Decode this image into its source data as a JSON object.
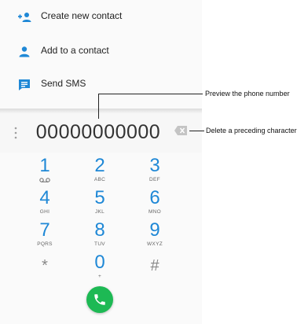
{
  "menu": {
    "items": [
      {
        "label": "Create new contact",
        "icon": "add-person-icon"
      },
      {
        "label": "Add to a contact",
        "icon": "person-icon"
      },
      {
        "label": "Send SMS",
        "icon": "sms-icon"
      }
    ]
  },
  "dialer": {
    "number": "00000000000",
    "overflow_icon": "more-vert-icon",
    "delete_icon": "backspace-icon"
  },
  "keypad": [
    {
      "digit": "1",
      "letters": "",
      "voicemail": true
    },
    {
      "digit": "2",
      "letters": "ABC"
    },
    {
      "digit": "3",
      "letters": "DEF"
    },
    {
      "digit": "4",
      "letters": "GHI"
    },
    {
      "digit": "5",
      "letters": "JKL"
    },
    {
      "digit": "6",
      "letters": "MNO"
    },
    {
      "digit": "7",
      "letters": "PQRS"
    },
    {
      "digit": "8",
      "letters": "TUV"
    },
    {
      "digit": "9",
      "letters": "WXYZ"
    },
    {
      "digit": "*",
      "letters": ""
    },
    {
      "digit": "0",
      "letters": "+"
    },
    {
      "digit": "#",
      "letters": ""
    }
  ],
  "call_button": {
    "icon": "phone-icon"
  },
  "annotations": {
    "preview": "Preview the phone number",
    "delete": "Delete a preceding character"
  },
  "colors": {
    "accent": "#1f88d6",
    "call": "#1db954"
  }
}
